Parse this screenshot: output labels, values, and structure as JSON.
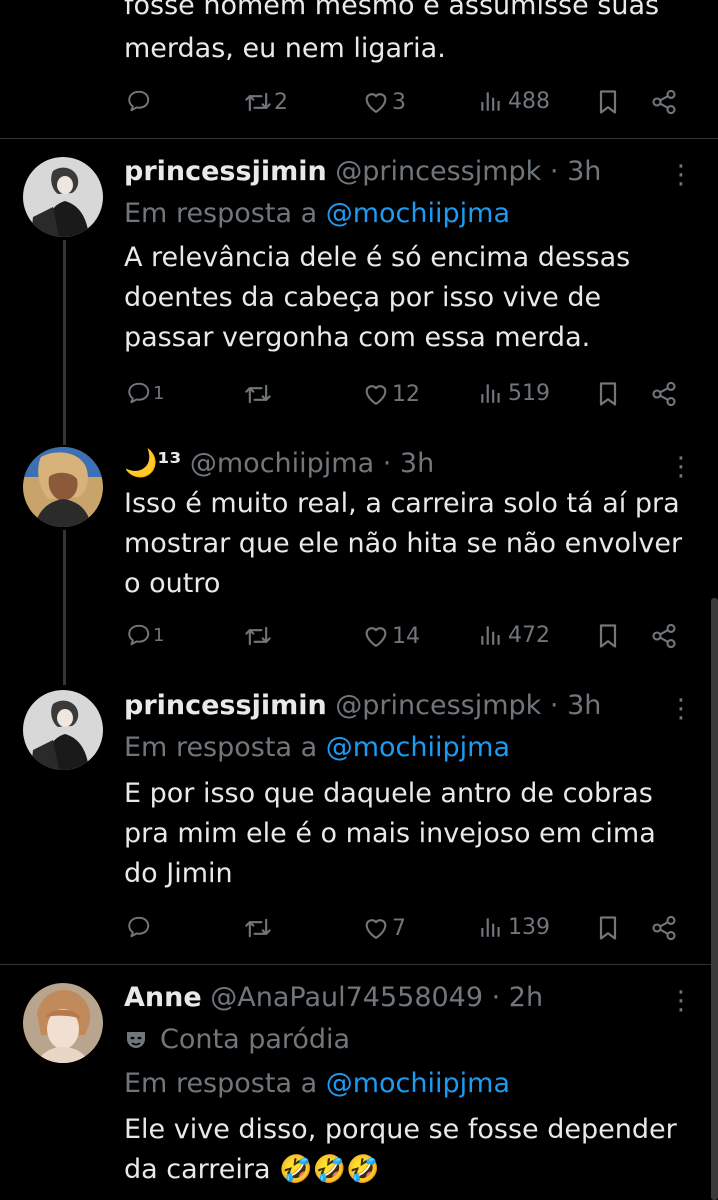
{
  "top_tweet": {
    "text_line1": "fosse homem mesmo e assumisse suas",
    "text_line2": "merdas, eu nem ligaria.",
    "retweets": "2",
    "likes": "3",
    "views": "488"
  },
  "replies": [
    {
      "name": "princessjimin",
      "handle": "@princessjmpk",
      "time": "· 3h",
      "reply_prefix": "Em resposta a",
      "reply_to": "@mochiipjma",
      "text": "A relevância dele é só encima dessas doentes da cabeça por isso vive de passar vergonha com essa merda.",
      "replies": "1",
      "retweets": "",
      "likes": "12",
      "views": "519"
    },
    {
      "name": "🌙¹³",
      "handle": "@mochiipjma",
      "time": "· 3h",
      "text": "Isso é muito real, a carreira solo tá aí pra mostrar que ele não hita se não envolver o outro",
      "replies": "1",
      "retweets": "",
      "likes": "14",
      "views": "472"
    },
    {
      "name": "princessjimin",
      "handle": "@princessjmpk",
      "time": "· 3h",
      "reply_prefix": "Em resposta a",
      "reply_to": "@mochiipjma",
      "text": "E por isso que daquele antro de cobras pra mim ele é o mais invejoso em cima do Jimin",
      "replies": "",
      "retweets": "",
      "likes": "7",
      "views": "139"
    },
    {
      "name": "Anne",
      "handle": "@AnaPaul74558049",
      "time": "· 2h",
      "parody_label": "Conta paródia",
      "reply_prefix": "Em resposta a",
      "reply_to": "@mochiipjma",
      "text": "Ele vive disso, porque se fosse depender da carreira 🤣🤣🤣"
    }
  ],
  "icons": [
    "reply-icon",
    "retweet-icon",
    "like-icon",
    "views-icon",
    "bookmark-icon",
    "share-icon",
    "more-icon",
    "parody-mask-icon"
  ],
  "colors": {
    "background": "#000000",
    "text": "#e7e9ea",
    "muted": "#71767b",
    "link": "#1d9bf0",
    "divider": "#2f3336"
  }
}
